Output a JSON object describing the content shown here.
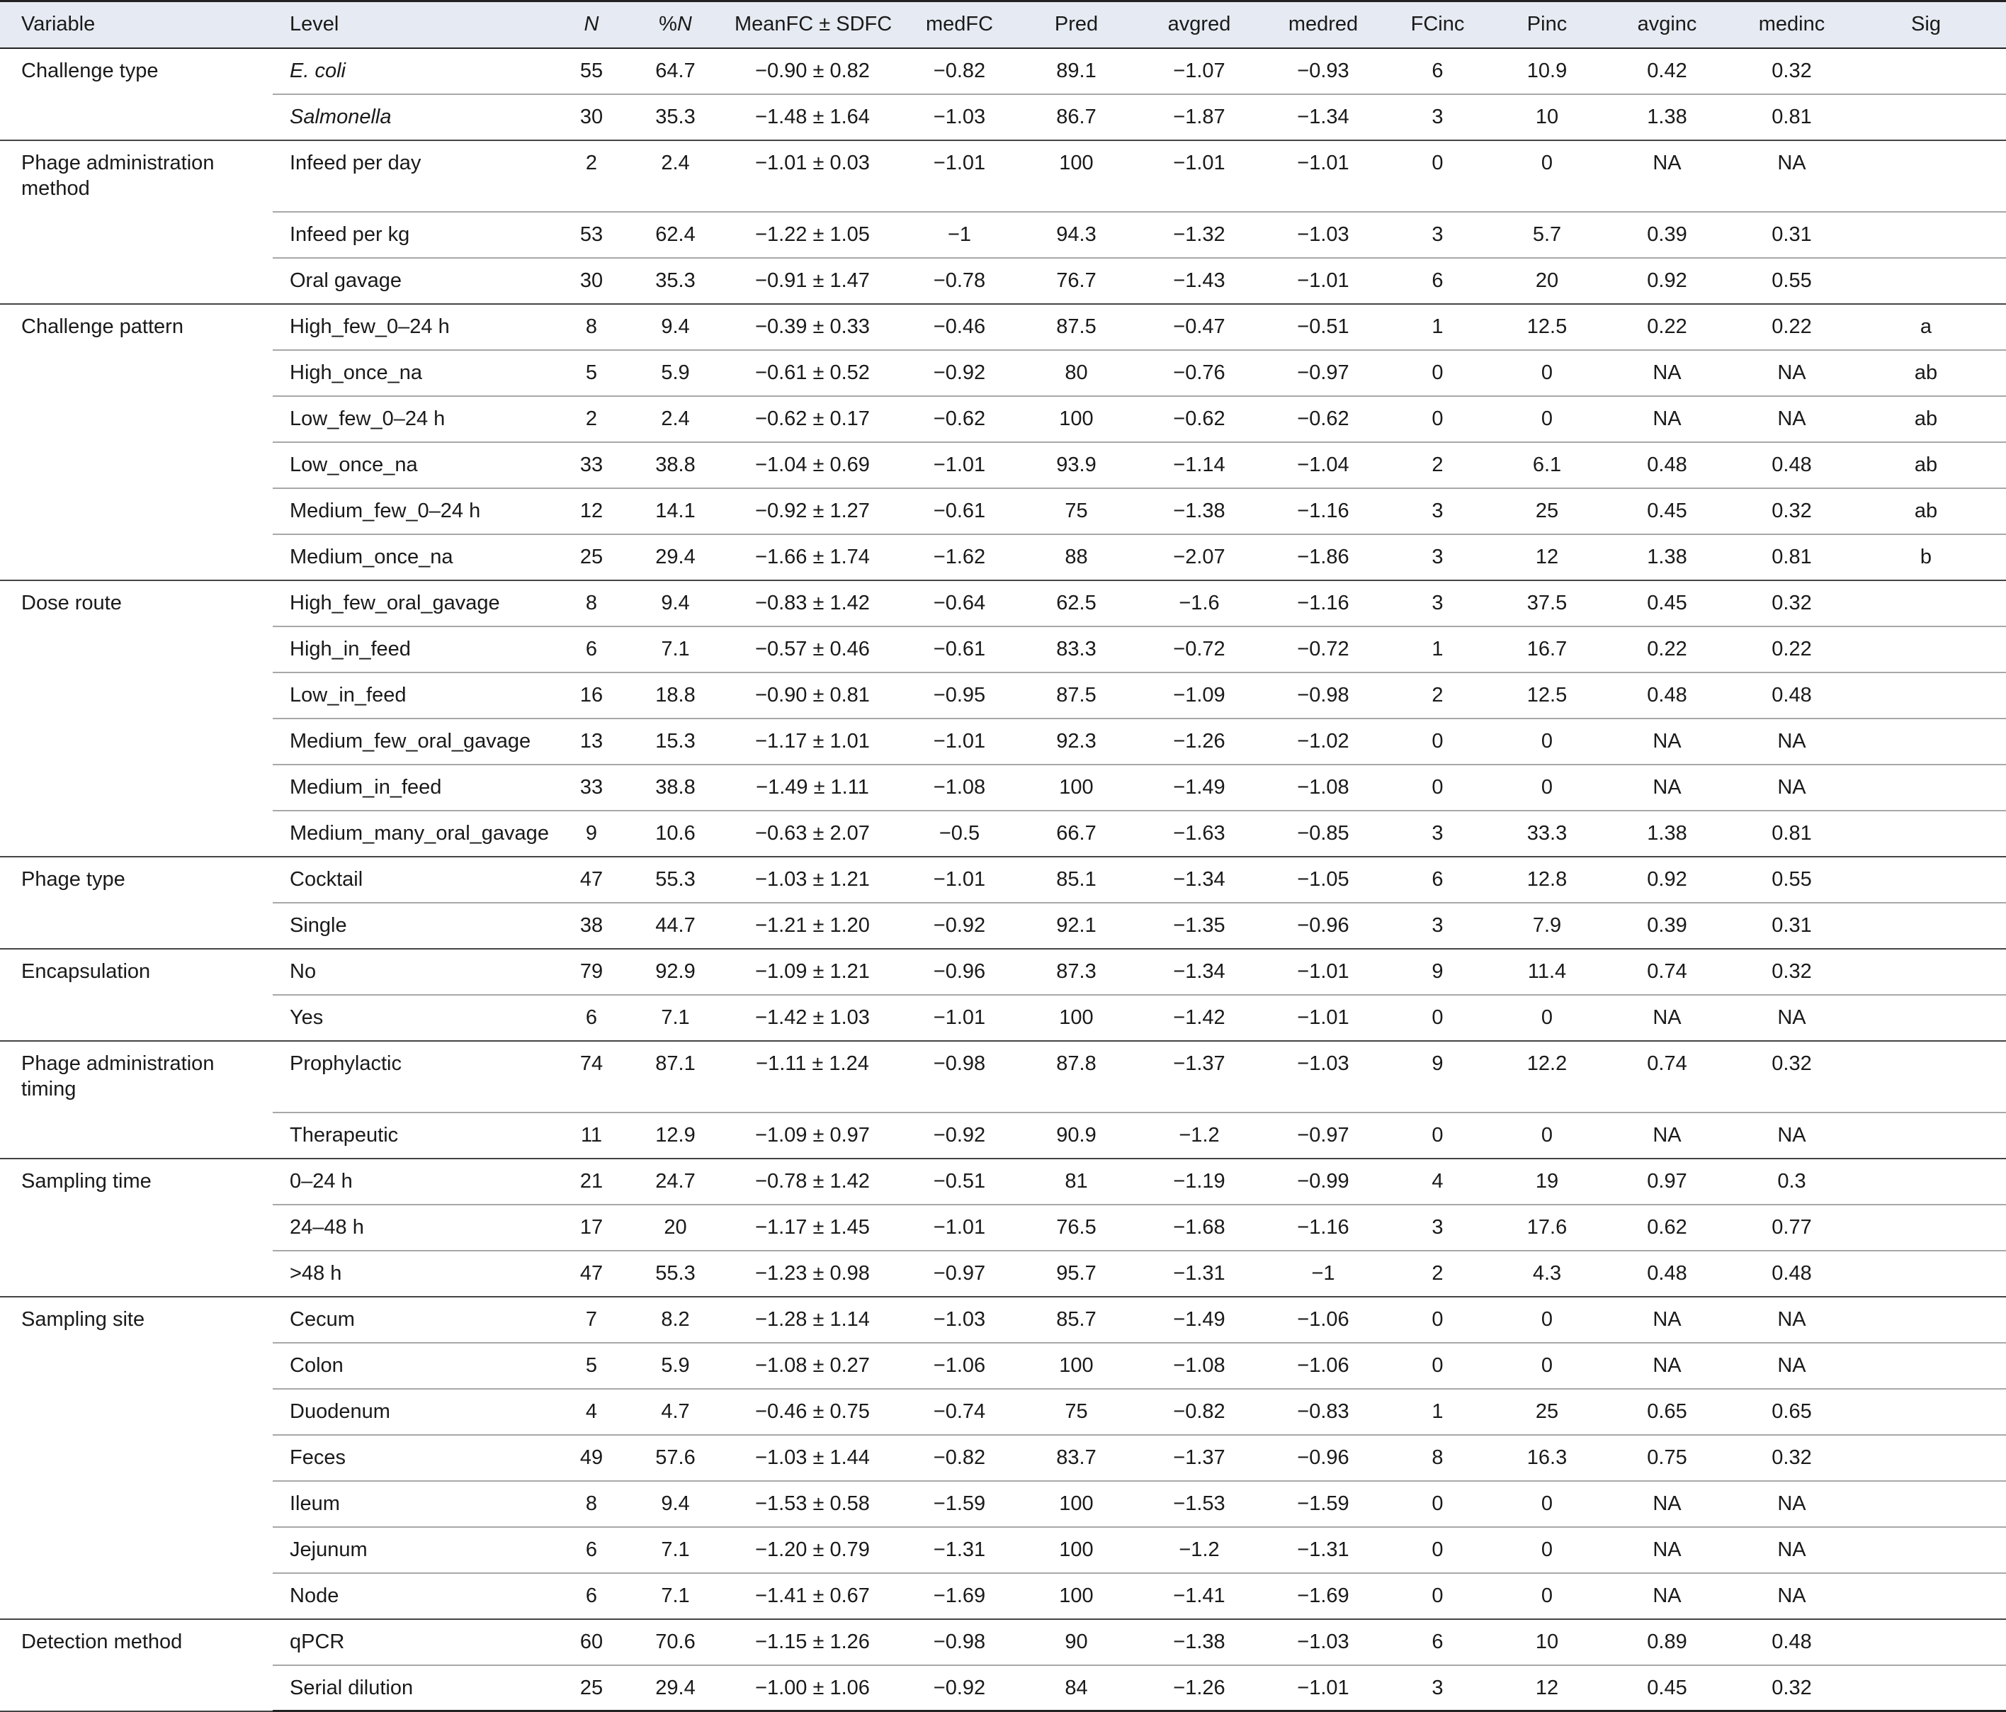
{
  "headers": [
    "Variable",
    "Level",
    "N",
    "%N",
    "MeanFC ± SDFC",
    "medFC",
    "Pred",
    "avgred",
    "medred",
    "FCinc",
    "Pinc",
    "avginc",
    "medinc",
    "Sig"
  ],
  "groups": [
    {
      "variable": "Challenge type",
      "rows": [
        [
          "E. coli",
          "55",
          "64.7",
          "−0.90 ± 0.82",
          "−0.82",
          "89.1",
          "−1.07",
          "−0.93",
          "6",
          "10.9",
          "0.42",
          "0.32",
          ""
        ],
        [
          "Salmonella",
          "30",
          "35.3",
          "−1.48 ± 1.64",
          "−1.03",
          "86.7",
          "−1.87",
          "−1.34",
          "3",
          "10",
          "1.38",
          "0.81",
          ""
        ]
      ]
    },
    {
      "variable": "Phage administration method",
      "rows": [
        [
          "Infeed per day",
          "2",
          "2.4",
          "−1.01 ± 0.03",
          "−1.01",
          "100",
          "−1.01",
          "−1.01",
          "0",
          "0",
          "NA",
          "NA",
          ""
        ],
        [
          "Infeed per kg",
          "53",
          "62.4",
          "−1.22 ± 1.05",
          "−1",
          "94.3",
          "−1.32",
          "−1.03",
          "3",
          "5.7",
          "0.39",
          "0.31",
          ""
        ],
        [
          "Oral gavage",
          "30",
          "35.3",
          "−0.91 ± 1.47",
          "−0.78",
          "76.7",
          "−1.43",
          "−1.01",
          "6",
          "20",
          "0.92",
          "0.55",
          ""
        ]
      ]
    },
    {
      "variable": "Challenge pattern",
      "rows": [
        [
          "High_few_0–24 h",
          "8",
          "9.4",
          "−0.39 ± 0.33",
          "−0.46",
          "87.5",
          "−0.47",
          "−0.51",
          "1",
          "12.5",
          "0.22",
          "0.22",
          "a"
        ],
        [
          "High_once_na",
          "5",
          "5.9",
          "−0.61 ± 0.52",
          "−0.92",
          "80",
          "−0.76",
          "−0.97",
          "0",
          "0",
          "NA",
          "NA",
          "ab"
        ],
        [
          "Low_few_0–24 h",
          "2",
          "2.4",
          "−0.62 ± 0.17",
          "−0.62",
          "100",
          "−0.62",
          "−0.62",
          "0",
          "0",
          "NA",
          "NA",
          "ab"
        ],
        [
          "Low_once_na",
          "33",
          "38.8",
          "−1.04 ± 0.69",
          "−1.01",
          "93.9",
          "−1.14",
          "−1.04",
          "2",
          "6.1",
          "0.48",
          "0.48",
          "ab"
        ],
        [
          "Medium_few_0–24 h",
          "12",
          "14.1",
          "−0.92 ± 1.27",
          "−0.61",
          "75",
          "−1.38",
          "−1.16",
          "3",
          "25",
          "0.45",
          "0.32",
          "ab"
        ],
        [
          "Medium_once_na",
          "25",
          "29.4",
          "−1.66 ± 1.74",
          "−1.62",
          "88",
          "−2.07",
          "−1.86",
          "3",
          "12",
          "1.38",
          "0.81",
          "b"
        ]
      ]
    },
    {
      "variable": "Dose route",
      "rows": [
        [
          "High_few_oral_gavage",
          "8",
          "9.4",
          "−0.83 ± 1.42",
          "−0.64",
          "62.5",
          "−1.6",
          "−1.16",
          "3",
          "37.5",
          "0.45",
          "0.32",
          ""
        ],
        [
          "High_in_feed",
          "6",
          "7.1",
          "−0.57 ± 0.46",
          "−0.61",
          "83.3",
          "−0.72",
          "−0.72",
          "1",
          "16.7",
          "0.22",
          "0.22",
          ""
        ],
        [
          "Low_in_feed",
          "16",
          "18.8",
          "−0.90 ± 0.81",
          "−0.95",
          "87.5",
          "−1.09",
          "−0.98",
          "2",
          "12.5",
          "0.48",
          "0.48",
          ""
        ],
        [
          "Medium_few_oral_gavage",
          "13",
          "15.3",
          "−1.17 ± 1.01",
          "−1.01",
          "92.3",
          "−1.26",
          "−1.02",
          "0",
          "0",
          "NA",
          "NA",
          ""
        ],
        [
          "Medium_in_feed",
          "33",
          "38.8",
          "−1.49 ± 1.11",
          "−1.08",
          "100",
          "−1.49",
          "−1.08",
          "0",
          "0",
          "NA",
          "NA",
          ""
        ],
        [
          "Medium_many_oral_gavage",
          "9",
          "10.6",
          "−0.63 ± 2.07",
          "−0.5",
          "66.7",
          "−1.63",
          "−0.85",
          "3",
          "33.3",
          "1.38",
          "0.81",
          ""
        ]
      ]
    },
    {
      "variable": "Phage type",
      "rows": [
        [
          "Cocktail",
          "47",
          "55.3",
          "−1.03 ± 1.21",
          "−1.01",
          "85.1",
          "−1.34",
          "−1.05",
          "6",
          "12.8",
          "0.92",
          "0.55",
          ""
        ],
        [
          "Single",
          "38",
          "44.7",
          "−1.21 ± 1.20",
          "−0.92",
          "92.1",
          "−1.35",
          "−0.96",
          "3",
          "7.9",
          "0.39",
          "0.31",
          ""
        ]
      ]
    },
    {
      "variable": "Encapsulation",
      "rows": [
        [
          "No",
          "79",
          "92.9",
          "−1.09 ± 1.21",
          "−0.96",
          "87.3",
          "−1.34",
          "−1.01",
          "9",
          "11.4",
          "0.74",
          "0.32",
          ""
        ],
        [
          "Yes",
          "6",
          "7.1",
          "−1.42 ± 1.03",
          "−1.01",
          "100",
          "−1.42",
          "−1.01",
          "0",
          "0",
          "NA",
          "NA",
          ""
        ]
      ]
    },
    {
      "variable": "Phage administration timing",
      "rows": [
        [
          "Prophylactic",
          "74",
          "87.1",
          "−1.11 ± 1.24",
          "−0.98",
          "87.8",
          "−1.37",
          "−1.03",
          "9",
          "12.2",
          "0.74",
          "0.32",
          ""
        ],
        [
          "Therapeutic",
          "11",
          "12.9",
          "−1.09 ± 0.97",
          "−0.92",
          "90.9",
          "−1.2",
          "−0.97",
          "0",
          "0",
          "NA",
          "NA",
          ""
        ]
      ]
    },
    {
      "variable": "Sampling time",
      "rows": [
        [
          "0–24 h",
          "21",
          "24.7",
          "−0.78 ± 1.42",
          "−0.51",
          "81",
          "−1.19",
          "−0.99",
          "4",
          "19",
          "0.97",
          "0.3",
          ""
        ],
        [
          "24–48 h",
          "17",
          "20",
          "−1.17 ± 1.45",
          "−1.01",
          "76.5",
          "−1.68",
          "−1.16",
          "3",
          "17.6",
          "0.62",
          "0.77",
          ""
        ],
        [
          ">48 h",
          "47",
          "55.3",
          "−1.23 ± 0.98",
          "−0.97",
          "95.7",
          "−1.31",
          "−1",
          "2",
          "4.3",
          "0.48",
          "0.48",
          ""
        ]
      ]
    },
    {
      "variable": "Sampling site",
      "rows": [
        [
          "Cecum",
          "7",
          "8.2",
          "−1.28 ± 1.14",
          "−1.03",
          "85.7",
          "−1.49",
          "−1.06",
          "0",
          "0",
          "NA",
          "NA",
          ""
        ],
        [
          "Colon",
          "5",
          "5.9",
          "−1.08 ± 0.27",
          "−1.06",
          "100",
          "−1.08",
          "−1.06",
          "0",
          "0",
          "NA",
          "NA",
          ""
        ],
        [
          "Duodenum",
          "4",
          "4.7",
          "−0.46 ± 0.75",
          "−0.74",
          "75",
          "−0.82",
          "−0.83",
          "1",
          "25",
          "0.65",
          "0.65",
          ""
        ],
        [
          "Feces",
          "49",
          "57.6",
          "−1.03 ± 1.44",
          "−0.82",
          "83.7",
          "−1.37",
          "−0.96",
          "8",
          "16.3",
          "0.75",
          "0.32",
          ""
        ],
        [
          "Ileum",
          "8",
          "9.4",
          "−1.53 ± 0.58",
          "−1.59",
          "100",
          "−1.53",
          "−1.59",
          "0",
          "0",
          "NA",
          "NA",
          ""
        ],
        [
          "Jejunum",
          "6",
          "7.1",
          "−1.20 ± 0.79",
          "−1.31",
          "100",
          "−1.2",
          "−1.31",
          "0",
          "0",
          "NA",
          "NA",
          ""
        ],
        [
          "Node",
          "6",
          "7.1",
          "−1.41 ± 0.67",
          "−1.69",
          "100",
          "−1.41",
          "−1.69",
          "0",
          "0",
          "NA",
          "NA",
          ""
        ]
      ]
    },
    {
      "variable": "Detection method",
      "rows": [
        [
          "qPCR",
          "60",
          "70.6",
          "−1.15 ± 1.26",
          "−0.98",
          "90",
          "−1.38",
          "−1.03",
          "6",
          "10",
          "0.89",
          "0.48",
          ""
        ],
        [
          "Serial dilution",
          "25",
          "29.4",
          "−1.00 ± 1.06",
          "−0.92",
          "84",
          "−1.26",
          "−1.01",
          "3",
          "12",
          "0.45",
          "0.32",
          ""
        ]
      ]
    }
  ]
}
